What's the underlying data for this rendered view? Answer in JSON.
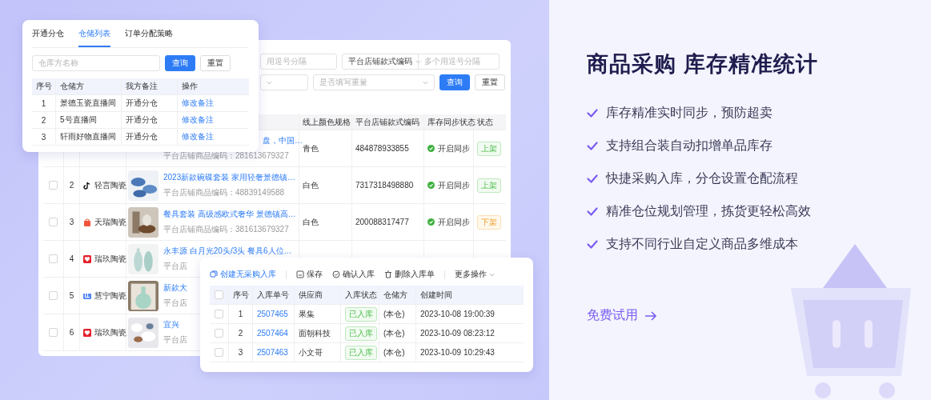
{
  "warehouse_card": {
    "tabs": [
      {
        "label": "开通分仓",
        "selected": false
      },
      {
        "label": "仓储列表",
        "selected": true
      },
      {
        "label": "订单分配策略",
        "selected": false
      }
    ],
    "search": {
      "placeholder": "仓库方名称"
    },
    "buttons": [
      "查询",
      "重置"
    ],
    "table": {
      "columns": [
        "序号",
        "仓储方",
        "我方备注",
        "操作"
      ],
      "rows": [
        {
          "index": "1",
          "warehouse": "景德玉瓷直播间",
          "note": "开通分仓",
          "action": "修改备注"
        },
        {
          "index": "2",
          "warehouse": "5号直播间",
          "note": "开通分仓",
          "action": "修改备注"
        },
        {
          "index": "3",
          "warehouse": "轩雨好物直播间",
          "note": "开通分仓",
          "action": "修改备注"
        }
      ]
    }
  },
  "product_card": {
    "filter_rows": [
      [
        {
          "kind": "input",
          "placeholder": "用逗号分隔"
        },
        {
          "kind": "select",
          "value": "平台店铺款式编码"
        },
        {
          "kind": "input",
          "placeholder": "多个用逗号分隔"
        }
      ],
      [
        {
          "kind": "select"
        },
        {
          "kind": "select",
          "placeholder": "是否填写重量"
        }
      ]
    ],
    "buttons": [
      "查询",
      "重置"
    ],
    "columns": [
      "线上颜色规格",
      "平台店铺款式编码",
      "库存同步状态",
      "状态"
    ],
    "rows": [
      {
        "title": "盘，中国…",
        "sku": "平台店铺商品编码：281613679327",
        "color_spec": "青色",
        "style_code": "484878933855",
        "sync": "开启同步",
        "status": {
          "label": "上架",
          "listed": true
        }
      },
      {
        "checked": false,
        "index": "2",
        "shop": {
          "name": "轻言陶瓷",
          "kind": "note"
        },
        "title": "2023新款碗碟套装 家用轻奢景德镇…",
        "sku": "平台店铺商品编码：48839149588",
        "color_spec": "白色",
        "style_code": "7317318498880",
        "sync": "开启同步",
        "status": {
          "label": "上架",
          "listed": true
        }
      },
      {
        "checked": false,
        "index": "3",
        "shop": {
          "name": "天瑞陶瓷",
          "kind": "bag"
        },
        "title": "餐具套装 高级感欧式奢华 景德镇高…",
        "sku": "平台店铺商品编码：381613679327",
        "color_spec": "白色",
        "style_code": "200088317477",
        "sync": "开启同步",
        "status": {
          "label": "下架",
          "listed": false
        }
      },
      {
        "checked": false,
        "index": "4",
        "shop": {
          "name": "瑞玖陶瓷",
          "kind": "heart"
        },
        "title": "永丰源 白月光20头/3头 餐具6人位…",
        "sku": "平台店"
      },
      {
        "checked": false,
        "index": "5",
        "shop": {
          "name": "慧宁陶瓷",
          "kind": "logo"
        },
        "title": "新款大",
        "sku": "平台店"
      },
      {
        "checked": false,
        "index": "6",
        "shop": {
          "name": "瑞玖陶瓷",
          "kind": "heart"
        },
        "title": "宜兴",
        "sku": "平台店"
      }
    ]
  },
  "receipt_card": {
    "toolbar": [
      {
        "label": "创建无采购入库",
        "kind": "create"
      },
      {
        "label": "保存",
        "kind": "save"
      },
      {
        "label": "确认入库",
        "kind": "confirm"
      },
      {
        "label": "删除入库单",
        "kind": "delete"
      },
      {
        "label": "更多操作",
        "kind": "more"
      }
    ],
    "header_checked": false,
    "columns": [
      "序号",
      "入库单号",
      "供应商",
      "入库状态",
      "仓储方",
      "创建时间"
    ],
    "rows": [
      {
        "checked": false,
        "index": "1",
        "number": "2507465",
        "supplier": "果集",
        "status": "已入库",
        "warehouse": "(本仓)",
        "created": "2023-10-08 19:00:39"
      },
      {
        "checked": false,
        "index": "2",
        "number": "2507464",
        "supplier": "面朝科技",
        "status": "已入库",
        "warehouse": "(本仓)",
        "created": "2023-10-09 08:23:12"
      },
      {
        "checked": false,
        "index": "3",
        "number": "2507463",
        "supplier": "小文哥",
        "status": "已入库",
        "warehouse": "(本仓)",
        "created": "2023-10-09 10:29:43"
      }
    ]
  },
  "promo": {
    "headline": "商品采购 库存精准统计",
    "features": [
      "库存精准实时同步，预防超卖",
      "支持组合装自动扣增单品库存",
      "快捷采购入库，分仓设置仓配流程",
      "精准仓位规划管理，拣货更轻松高效",
      "支持不同行业自定义商品多维成本"
    ],
    "cta": "免费试用"
  }
}
